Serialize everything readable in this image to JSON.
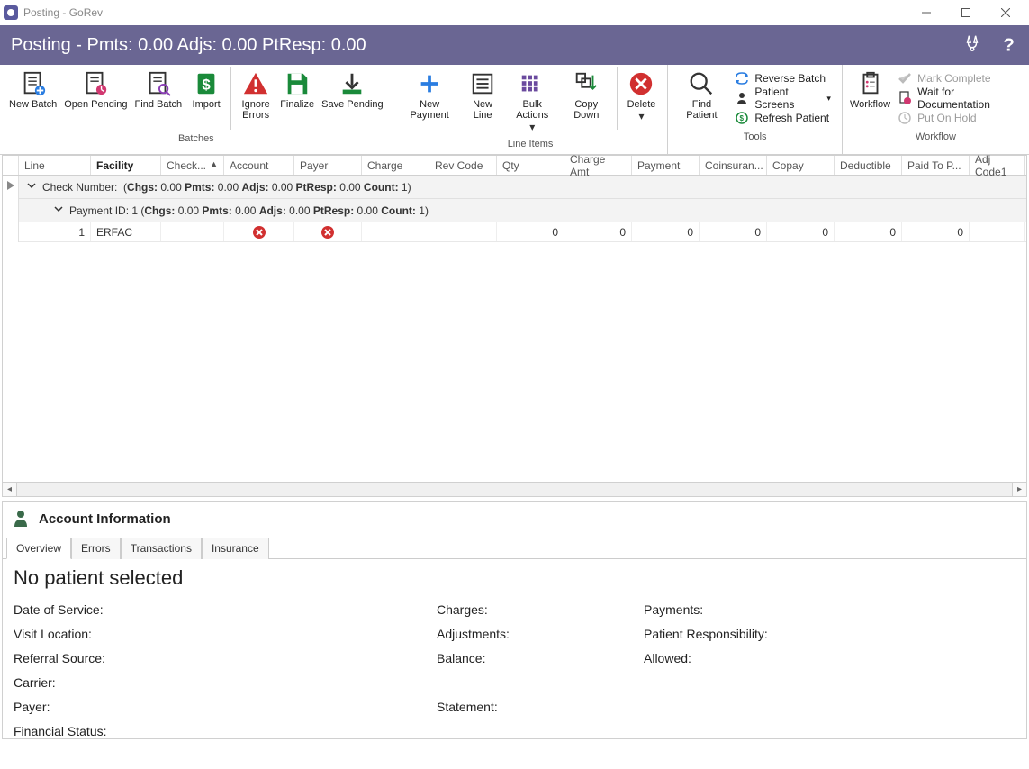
{
  "titlebar": {
    "title": "Posting - GoRev"
  },
  "header": {
    "title": "Posting - Pmts: 0.00 Adjs: 0.00 PtResp: 0.00"
  },
  "ribbon": {
    "batches": {
      "label": "Batches",
      "new_batch": "New Batch",
      "open_pending": "Open Pending",
      "find_batch": "Find Batch",
      "import": "Import",
      "ignore_errors": "Ignore\nErrors",
      "finalize": "Finalize",
      "save_pending": "Save Pending"
    },
    "lineitems": {
      "label": "Line Items",
      "new_payment": "New Payment",
      "new_line": "New Line",
      "bulk_actions": "Bulk Actions",
      "copy_down": "Copy Down",
      "delete": "Delete"
    },
    "tools": {
      "label": "Tools",
      "find_patient": "Find Patient",
      "reverse_batch": "Reverse Batch",
      "patient_screens": "Patient Screens",
      "refresh_patient": "Refresh Patient"
    },
    "workflow": {
      "label": "Workflow",
      "workflow": "Workflow",
      "mark_complete": "Mark Complete",
      "wait_documentation": "Wait for Documentation",
      "put_on_hold": "Put On Hold"
    }
  },
  "grid": {
    "columns": [
      "Line",
      "Facility",
      "Check...",
      "Account",
      "Payer",
      "Charge",
      "Rev Code",
      "Qty",
      "Charge Amt",
      "Payment",
      "Coinsuran...",
      "Copay",
      "Deductible",
      "Paid To P...",
      "Adj Code1"
    ],
    "group1_label": "Check Number:",
    "group1_stats": {
      "prefix": "(",
      "chgs_l": "Chgs:",
      "chgs": "0.00",
      "pmts_l": "Pmts:",
      "pmts": "0.00",
      "adjs_l": "Adjs:",
      "adjs": "0.00",
      "ptresp_l": "PtResp:",
      "ptresp": "0.00",
      "count_l": "Count:",
      "count": "1",
      "suffix": ")"
    },
    "group2_label": "Payment ID: 1",
    "group2_stats": {
      "prefix": "(",
      "chgs_l": "Chgs:",
      "chgs": "0.00",
      "pmts_l": "Pmts:",
      "pmts": "0.00",
      "adjs_l": "Adjs:",
      "adjs": "0.00",
      "ptresp_l": "PtResp:",
      "ptresp": "0.00",
      "count_l": "Count:",
      "count": "1",
      "suffix": ")"
    },
    "row": {
      "line": "1",
      "facility": "ERFAC",
      "check": "",
      "account": "",
      "payer": "",
      "charge": "",
      "revcode": "",
      "qty": "0",
      "chargeamt": "0",
      "payment": "0",
      "coins": "0",
      "copay": "0",
      "deduct": "0",
      "paidtop": "0"
    }
  },
  "account": {
    "title": "Account Information",
    "tabs": [
      "Overview",
      "Errors",
      "Transactions",
      "Insurance"
    ],
    "message": "No patient selected",
    "labels": {
      "dos": "Date of Service:",
      "visit": "Visit Location:",
      "referral": "Referral Source:",
      "carrier": "Carrier:",
      "payer": "Payer:",
      "finstatus": "Financial Status:",
      "charges": "Charges:",
      "adjustments": "Adjustments:",
      "balance": "Balance:",
      "statement": "Statement:",
      "payments": "Payments:",
      "ptresp": "Patient Responsibility:",
      "allowed": "Allowed:"
    }
  }
}
